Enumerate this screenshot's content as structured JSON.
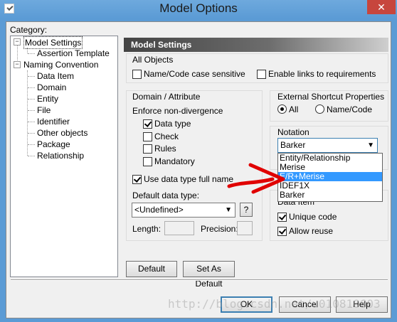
{
  "window": {
    "title": "Model Options",
    "close_glyph": "✕"
  },
  "category": {
    "label": "Category:",
    "tree": [
      {
        "label": "Model Settings",
        "level": 1,
        "expander": "−",
        "selected": true
      },
      {
        "label": "Assertion Template",
        "level": 2
      },
      {
        "label": "Naming Convention",
        "level": 1,
        "expander": "−"
      },
      {
        "label": "Data Item",
        "level": 2
      },
      {
        "label": "Domain",
        "level": 2
      },
      {
        "label": "Entity",
        "level": 2
      },
      {
        "label": "File",
        "level": 2
      },
      {
        "label": "Identifier",
        "level": 2
      },
      {
        "label": "Other objects",
        "level": 2
      },
      {
        "label": "Package",
        "level": 2
      },
      {
        "label": "Relationship",
        "level": 2
      }
    ]
  },
  "panel": {
    "header": "Model Settings",
    "all_objects": {
      "title": "All Objects",
      "name_code_case_sensitive": {
        "label": "Name/Code case sensitive",
        "checked": false
      },
      "enable_links": {
        "label": "Enable links to requirements",
        "checked": false
      }
    },
    "domain_attribute": {
      "title": "Domain / Attribute",
      "enforce_label": "Enforce non-divergence",
      "data_type": {
        "label": "Data type",
        "checked": true
      },
      "check": {
        "label": "Check",
        "checked": false
      },
      "rules": {
        "label": "Rules",
        "checked": false
      },
      "mandatory": {
        "label": "Mandatory",
        "checked": false
      },
      "use_full_name": {
        "label": "Use data type full name",
        "checked": true
      },
      "default_type_label": "Default data type:",
      "default_type_value": "<Undefined>",
      "help_glyph": "?",
      "length_label": "Length:",
      "precision_label": "Precision:"
    },
    "shortcut": {
      "title": "External Shortcut Properties",
      "all": {
        "label": "All",
        "selected": true
      },
      "name_code": {
        "label": "Name/Code",
        "selected": false
      }
    },
    "notation": {
      "title": "Notation",
      "value": "Barker",
      "options": [
        "Entity/Relationship",
        "Merise",
        "E/R+Merise",
        "IDEF1X",
        "Barker"
      ],
      "highlighted": "E/R+Merise"
    },
    "data_item": {
      "title": "Data Item",
      "unique_code": {
        "label": "Unique code",
        "checked": true
      },
      "allow_reuse": {
        "label": "Allow reuse",
        "checked": true
      }
    },
    "default_button": "Default",
    "set_as_default_button": "Set As Default"
  },
  "footer": {
    "ok": "OK",
    "cancel": "Cancel",
    "help": "Help"
  },
  "watermark": "http://blog.csdn.net/u010810603",
  "annotation_color": "#e00000"
}
